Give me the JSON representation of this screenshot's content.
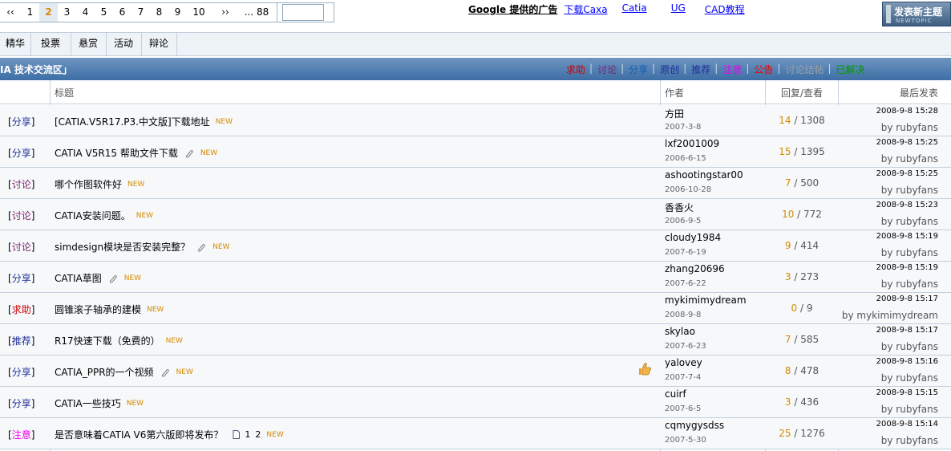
{
  "pager": {
    "prev": "‹‹",
    "pages": [
      "1",
      "2",
      "3",
      "4",
      "5",
      "6",
      "7",
      "8",
      "9",
      "10"
    ],
    "current": "2",
    "next": "››",
    "last": "... 88"
  },
  "ads": {
    "label": "Google 提供的广告",
    "links": [
      "下载Caxa",
      "Catia",
      "UG",
      "CAD教程"
    ]
  },
  "new_topic": {
    "label": "发表新主题",
    "sub": "NEWTOPIC"
  },
  "filters": [
    "精华",
    "投票",
    "悬赏",
    "活动",
    "辩论"
  ],
  "forum": {
    "name": "IA 技术交流区」",
    "categories": [
      {
        "label": "求助",
        "color": "#cc0000"
      },
      {
        "label": "讨论",
        "color": "#7a1f6e"
      },
      {
        "label": "分享",
        "color": "#0b5fb3"
      },
      {
        "label": "原创",
        "color": "#1f2f99"
      },
      {
        "label": "推荐",
        "color": "#1f2f99"
      },
      {
        "label": "注意",
        "color": "#ee00ee"
      },
      {
        "label": "公告",
        "color": "#ee0000"
      },
      {
        "label": "讨论结帖",
        "color": "#9aa0a6"
      },
      {
        "label": "已解决",
        "color": "#009900"
      }
    ]
  },
  "columns": {
    "title": "标题",
    "author": "作者",
    "replies": "回复/查看",
    "last": "最后发表"
  },
  "colors": {
    "new": "#d58a00",
    "reply_count": "#d58a00",
    "grid": "#c3d0dc",
    "header_bar": "#4a7ab0"
  },
  "rows": [
    {
      "tag": "分享",
      "tag_color": "#1f2f99",
      "title": "[CATIA.V5R17.P3.中文版]下载地址",
      "new": "NEW",
      "attach": false,
      "author": "方田",
      "adate": "2007-3-8",
      "replies": "14",
      "views": "1308",
      "last": "2008-9-8 15:28",
      "by": "by rubyfans"
    },
    {
      "tag": "分享",
      "tag_color": "#1f2f99",
      "title": "CATIA V5R15 帮助文件下载",
      "new": "NEW",
      "attach": true,
      "author": "lxf2001009",
      "adate": "2006-6-15",
      "replies": "15",
      "views": "1395",
      "last": "2008-9-8 15:25",
      "by": "by rubyfans"
    },
    {
      "tag": "讨论",
      "tag_color": "#7a1f6e",
      "title": "哪个作图软件好",
      "new": "NEW",
      "attach": false,
      "author": "ashootingstar00",
      "adate": "2006-10-28",
      "replies": "7",
      "views": "500",
      "last": "2008-9-8 15:25",
      "by": "by rubyfans"
    },
    {
      "tag": "讨论",
      "tag_color": "#7a1f6e",
      "title": "CATIA安装问题。",
      "new": "NEW",
      "attach": false,
      "author": "香香火",
      "adate": "2006-9-5",
      "replies": "10",
      "views": "772",
      "last": "2008-9-8 15:23",
      "by": "by rubyfans"
    },
    {
      "tag": "讨论",
      "tag_color": "#7a1f6e",
      "title": "simdesign模块是否安装完整？",
      "new": "NEW",
      "attach": true,
      "author": "cloudy1984",
      "adate": "2007-6-19",
      "replies": "9",
      "views": "414",
      "last": "2008-9-8 15:19",
      "by": "by rubyfans"
    },
    {
      "tag": "分享",
      "tag_color": "#1f2f99",
      "title": "CATIA草图",
      "new": "NEW",
      "attach": true,
      "author": "zhang20696",
      "adate": "2007-6-22",
      "replies": "3",
      "views": "273",
      "last": "2008-9-8 15:19",
      "by": "by rubyfans"
    },
    {
      "tag": "求助",
      "tag_color": "#cc0000",
      "title": "圆锥滚子轴承的建模",
      "new": "NEW",
      "attach": false,
      "author": "mykimimydream",
      "adate": "2008-9-8",
      "replies": "0",
      "views": "9",
      "last": "2008-9-8 15:17",
      "by": "by mykimimydream"
    },
    {
      "tag": "推荐",
      "tag_color": "#1f2f99",
      "title": "R17快速下载（免费的）",
      "new": "NEW",
      "attach": false,
      "author": "skylao",
      "adate": "2007-6-23",
      "replies": "7",
      "views": "585",
      "last": "2008-9-8 15:17",
      "by": "by rubyfans"
    },
    {
      "tag": "分享",
      "tag_color": "#1f2f99",
      "title": "CATIA_PPR的一个视频",
      "new": "NEW",
      "attach": true,
      "thumb": true,
      "author": "yalovey",
      "adate": "2007-7-4",
      "replies": "8",
      "views": "478",
      "last": "2008-9-8 15:16",
      "by": "by rubyfans"
    },
    {
      "tag": "分享",
      "tag_color": "#1f2f99",
      "title": "CATIA一些技巧",
      "new": "NEW",
      "attach": false,
      "author": "cuirf",
      "adate": "2007-6-5",
      "replies": "3",
      "views": "436",
      "last": "2008-9-8 15:15",
      "by": "by rubyfans"
    },
    {
      "tag": "注意",
      "tag_color": "#ee00ee",
      "title": "是否意味着CATIA V6第六版即将发布？",
      "new": "NEW",
      "attach": false,
      "pages": [
        "1",
        "2"
      ],
      "author": "cqmygysdss",
      "adate": "2007-5-30",
      "replies": "25",
      "views": "1276",
      "last": "2008-9-8 15:14",
      "by": "by rubyfans"
    }
  ]
}
